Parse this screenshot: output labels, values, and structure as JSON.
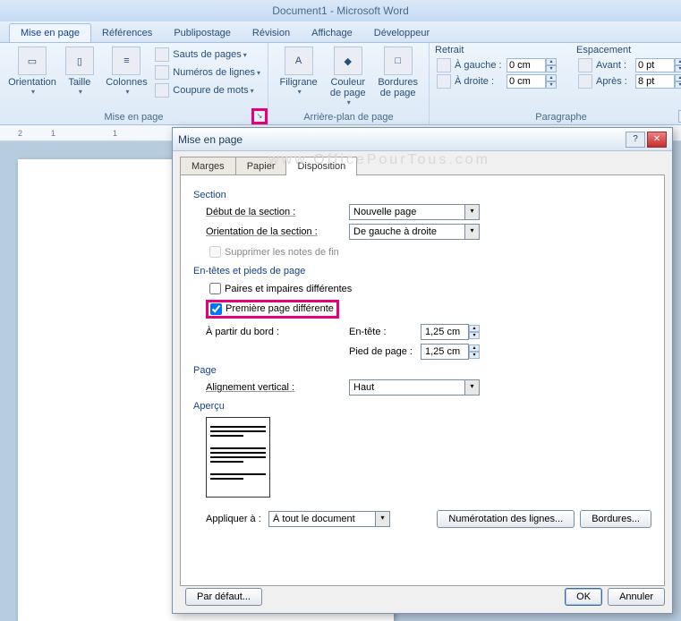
{
  "app_title": "Document1 - Microsoft Word",
  "watermark": "www.OfficePourTous.com",
  "ribbon_tabs": {
    "active": "Mise en page",
    "others": [
      "Références",
      "Publipostage",
      "Révision",
      "Affichage",
      "Développeur"
    ]
  },
  "groups": {
    "mise_en_page": {
      "label": "Mise en page",
      "orientation": "Orientation",
      "taille": "Taille",
      "colonnes": "Colonnes",
      "sauts": "Sauts de pages",
      "numeros": "Numéros de lignes",
      "coupure": "Coupure de mots"
    },
    "arriere_plan": {
      "label": "Arrière-plan de page",
      "filigrane": "Filigrane",
      "couleur": "Couleur de page",
      "bordures": "Bordures de page"
    },
    "paragraphe": {
      "label": "Paragraphe",
      "retrait": "Retrait",
      "gauche": "À gauche :",
      "gauche_val": "0 cm",
      "droite": "À droite :",
      "droite_val": "0 cm",
      "espacement": "Espacement",
      "avant": "Avant :",
      "avant_val": "0 pt",
      "apres": "Après :",
      "apres_val": "8 pt"
    }
  },
  "ruler": [
    "2",
    "1",
    "",
    "1"
  ],
  "dialog": {
    "title": "Mise en page",
    "tabs": {
      "marges": "Marges",
      "papier": "Papier",
      "disposition": "Disposition"
    },
    "section_h": "Section",
    "debut_lbl": "Début de la section :",
    "debut_val": "Nouvelle page",
    "orient_lbl": "Orientation de la section :",
    "orient_val": "De gauche à droite",
    "supprimer": "Supprimer les notes de fin",
    "entetes_h": "En-têtes et pieds de page",
    "paires": "Paires et impaires différentes",
    "premiere": "Première page différente",
    "apartir": "À partir du bord :",
    "entete_lbl": "En-tête :",
    "entete_val": "1,25 cm",
    "pied_lbl": "Pied de page :",
    "pied_val": "1,25 cm",
    "page_h": "Page",
    "align_lbl": "Alignement vertical :",
    "align_val": "Haut",
    "apercu_h": "Aperçu",
    "appliquer_lbl": "Appliquer à :",
    "appliquer_val": "À tout le document",
    "numerotation": "Numérotation des lignes...",
    "bordures_btn": "Bordures...",
    "defaut": "Par défaut...",
    "ok": "OK",
    "annuler": "Annuler"
  }
}
